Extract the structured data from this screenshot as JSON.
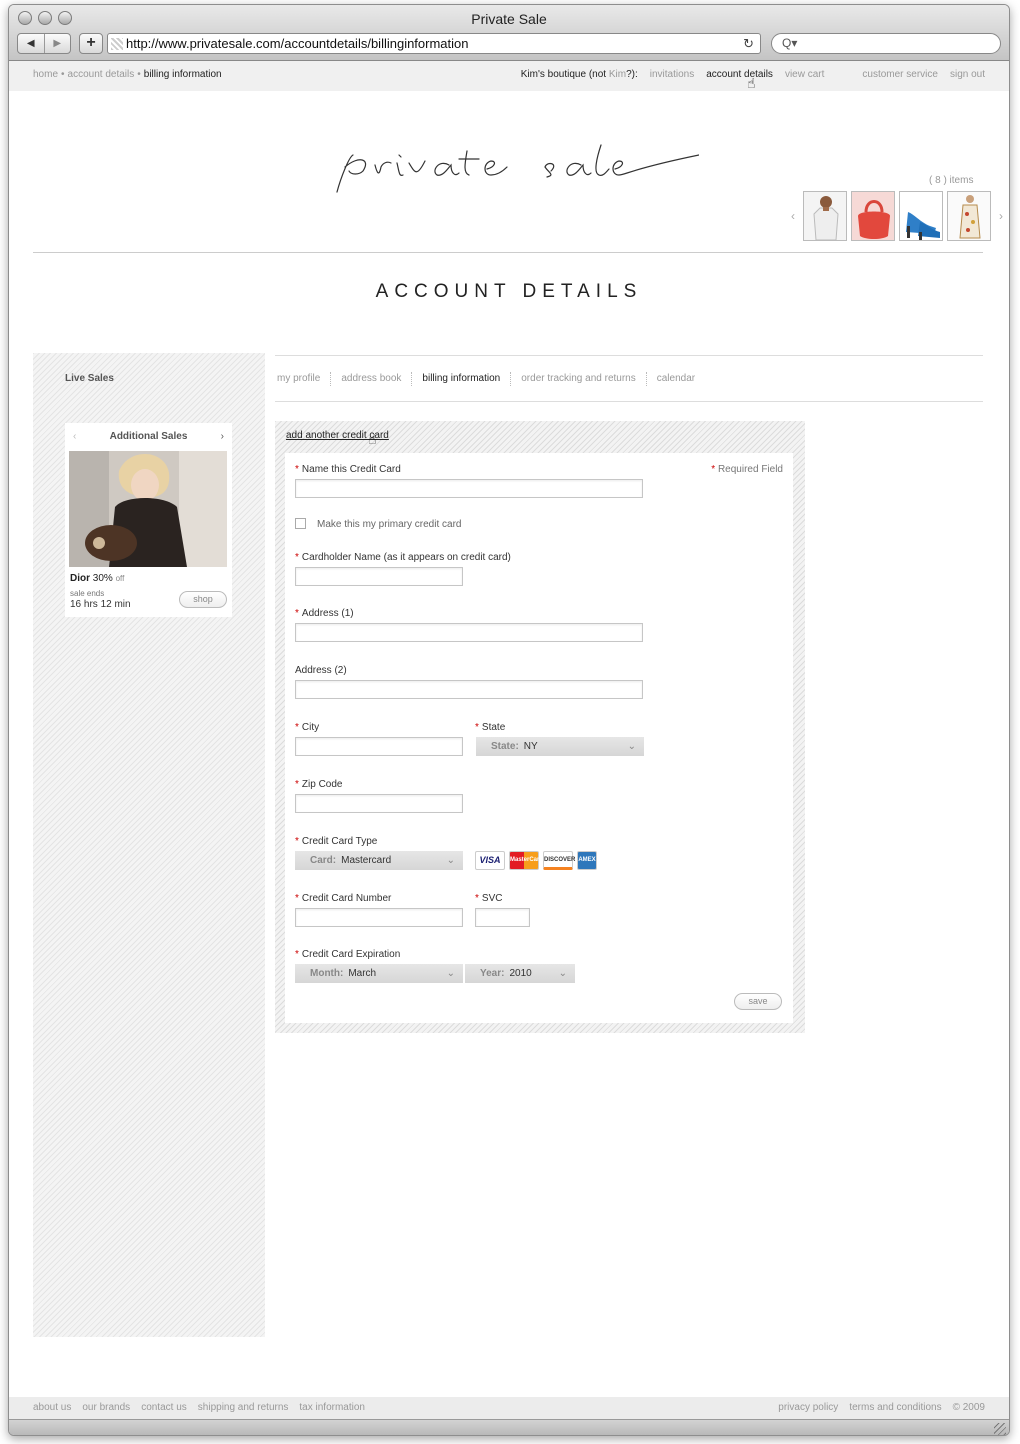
{
  "browser": {
    "title": "Private Sale",
    "url": "http://www.privatesale.com/accountdetails/billinginformation",
    "back": "◀",
    "forward": "▶",
    "add": "+",
    "reload": "↻",
    "search_icon": "Q▾"
  },
  "topnav": {
    "breadcrumb": [
      "home",
      "account details",
      "billing information"
    ],
    "breadcrumb_sep": "•",
    "boutique": "Kim's boutique (not ",
    "boutique_user": "Kim",
    "boutique_end": "?):",
    "invitations": "invitations",
    "account_details": "account details",
    "view_cart": "view cart",
    "customer_service": "customer service",
    "sign_out": "sign out"
  },
  "logo_text": "private sale",
  "cart": {
    "count_text": "( 8 ) items",
    "prev": "‹",
    "next": "›"
  },
  "page_title": "ACCOUNT DETAILS",
  "sidebar": {
    "live_sales": "Live Sales",
    "card": {
      "title": "Additional Sales",
      "prev": "‹",
      "next": "›",
      "brand": "Dior",
      "discount": "30%",
      "off": "off",
      "sale_ends": "sale ends",
      "time_left": "16 hrs 12 min",
      "shop": "shop"
    }
  },
  "tabs": [
    "my profile",
    "address book",
    "billing information",
    "order tracking and returns",
    "calendar"
  ],
  "active_tab": "billing information",
  "form": {
    "add_card_link": "add another credit card",
    "required_note": "Required Field",
    "asterisk": "*",
    "name_card_label": "Name this Credit Card",
    "primary_label": "Make this my primary credit card",
    "cardholder_label": "Cardholder Name (as it appears on credit card)",
    "address1_label": "Address (1)",
    "address2_label": "Address (2)",
    "city_label": "City",
    "state_label": "State",
    "state_key": "State:",
    "state_value": "NY",
    "zip_label": "Zip Code",
    "cc_type_label": "Credit Card Type",
    "card_key": "Card:",
    "card_value": "Mastercard",
    "card_logos": [
      "VISA",
      "MasterCard",
      "DISCOVER",
      "AMEX"
    ],
    "cc_number_label": "Credit Card Number",
    "svc_label": "SVC",
    "expiration_label": "Credit Card Expiration",
    "month_key": "Month:",
    "month_value": "March",
    "year_key": "Year:",
    "year_value": "2010",
    "save": "save",
    "chevron": "⌄"
  },
  "footer": {
    "left": [
      "about us",
      "our brands",
      "contact us",
      "shipping and returns",
      "tax information"
    ],
    "right": [
      "privacy policy",
      "terms and conditions",
      "© 2009"
    ]
  },
  "colors": {
    "required": "#cc0000",
    "muted_text": "#999999",
    "mastercard_red": "#e31b23",
    "visa_blue": "#1a1f71",
    "amex_blue": "#2e77bb",
    "discover_orange": "#f58220"
  }
}
